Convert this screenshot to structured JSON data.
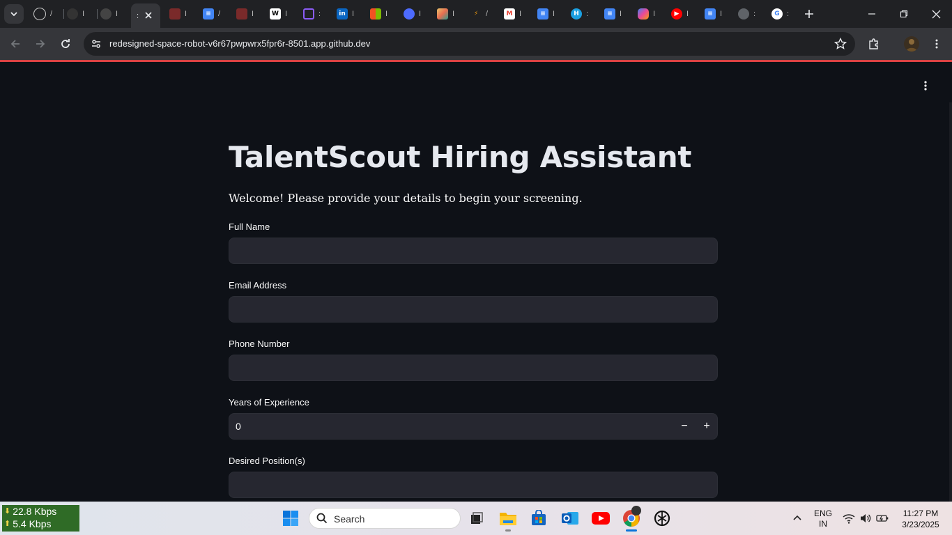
{
  "browser": {
    "tabs": [
      {
        "label": "/",
        "icon": "chatgpt-icon"
      },
      {
        "label": "I",
        "icon": "github-icon"
      },
      {
        "label": "I",
        "icon": "github-icon"
      },
      {
        "label": ":",
        "icon": "streamlit-icon",
        "active": true
      },
      {
        "label": "I",
        "icon": "anime-icon"
      },
      {
        "label": "/",
        "icon": "google-docs-icon"
      },
      {
        "label": "I",
        "icon": "anime-icon"
      },
      {
        "label": "I",
        "icon": "wikipedia-icon"
      },
      {
        "label": ":",
        "icon": "poe-icon"
      },
      {
        "label": "I",
        "icon": "linkedin-icon"
      },
      {
        "label": "I",
        "icon": "microsoft-icon"
      },
      {
        "label": "I",
        "icon": "deepseek-icon"
      },
      {
        "label": "I",
        "icon": "photo-icon"
      },
      {
        "label": "/",
        "icon": "arrow-logo-icon"
      },
      {
        "label": "I",
        "icon": "gmail-icon"
      },
      {
        "label": "I",
        "icon": "google-docs-icon"
      },
      {
        "label": ":",
        "icon": "hackerrank-icon"
      },
      {
        "label": "I",
        "icon": "google-docs-icon"
      },
      {
        "label": "I",
        "icon": "copilot-icon"
      },
      {
        "label": "I",
        "icon": "youtube-music-icon"
      },
      {
        "label": "I",
        "icon": "google-docs-icon"
      },
      {
        "label": ":",
        "icon": "globe-icon"
      },
      {
        "label": ":",
        "icon": "google-icon"
      }
    ],
    "url": "redesigned-space-robot-v6r67pwpwrx5fpr6r-8501.app.github.dev"
  },
  "page": {
    "title": "TalentScout Hiring Assistant",
    "intro": "Welcome! Please provide your details to begin your screening.",
    "fields": {
      "full_name": {
        "label": "Full Name",
        "value": ""
      },
      "email": {
        "label": "Email Address",
        "value": ""
      },
      "phone": {
        "label": "Phone Number",
        "value": ""
      },
      "experience": {
        "label": "Years of Experience",
        "value": "0",
        "minus": "−",
        "plus": "+"
      },
      "position": {
        "label": "Desired Position(s)",
        "value": ""
      }
    }
  },
  "taskbar": {
    "net_down": "22.8 Kbps",
    "net_up": "5.4 Kbps",
    "search_label": "Search",
    "lang_line1": "ENG",
    "lang_line2": "IN",
    "time": "11:27 PM",
    "date": "3/23/2025"
  },
  "colors": {
    "app_bg": "#0e1117",
    "input_bg": "#262730",
    "accent": "#ff4b4b",
    "chrome_dark": "#202124",
    "chrome_toolbar": "#35363a"
  }
}
